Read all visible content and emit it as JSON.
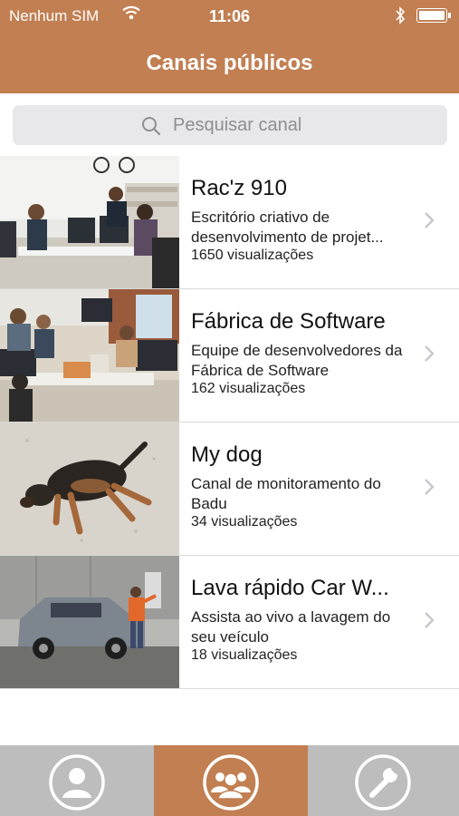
{
  "status_bar": {
    "carrier": "Nenhum SIM",
    "time": "11:06"
  },
  "header": {
    "title": "Canais públicos"
  },
  "search": {
    "placeholder": "Pesquisar canal"
  },
  "channels": [
    {
      "title": "Rac'z 910",
      "description": "Escritório criativo de desenvolvimento de projet...",
      "views": "1650 visualizações"
    },
    {
      "title": "Fábrica de Software",
      "description": "Equipe de desenvolvedores da Fábrica de Software",
      "views": "162 visualizações"
    },
    {
      "title": "My dog",
      "description": "Canal de monitoramento do Badu",
      "views": "34 visualizações"
    },
    {
      "title": "Lava rápido Car W...",
      "description": "Assista ao vivo a lavagem do seu veículo",
      "views": "18 visualizações"
    }
  ],
  "tabbar": {
    "active_tab": "channels",
    "tabs": [
      {
        "id": "profile",
        "icon": "user-icon"
      },
      {
        "id": "channels",
        "icon": "group-icon"
      },
      {
        "id": "settings",
        "icon": "wrench-icon"
      }
    ]
  },
  "colors": {
    "accent": "#c17f52",
    "tabbar": "#bdbdbd",
    "search_bg": "#e8e8ea"
  }
}
